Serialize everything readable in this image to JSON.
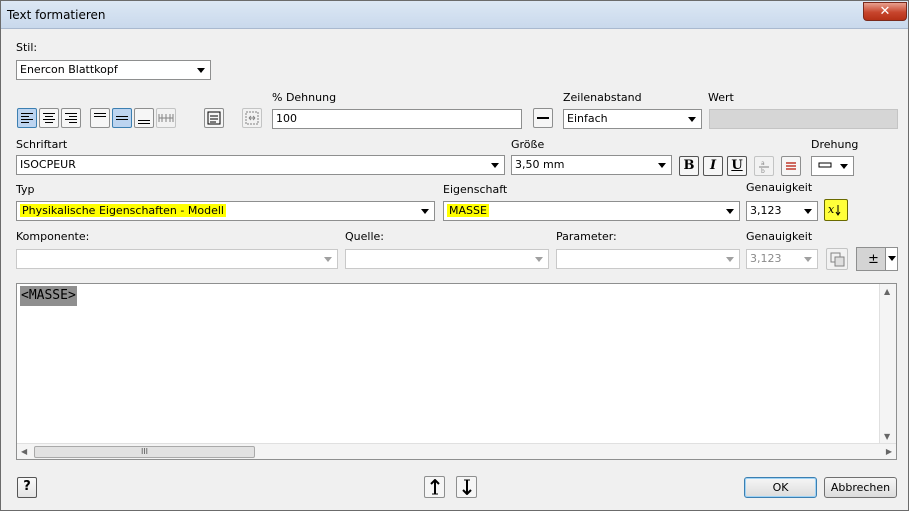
{
  "window": {
    "title": "Text formatieren",
    "close_glyph": "✕"
  },
  "style": {
    "label": "Stil:",
    "value": "Enercon Blattkopf"
  },
  "stretch": {
    "label": "% Dehnung",
    "value": "100"
  },
  "line_spacing": {
    "label": "Zeilenabstand",
    "value": "Einfach"
  },
  "value_field": {
    "label": "Wert",
    "value": ""
  },
  "font": {
    "label": "Schriftart",
    "value": "ISOCPEUR"
  },
  "size": {
    "label": "Größe",
    "value": "3,50 mm"
  },
  "format": {
    "bold": "B",
    "italic": "I",
    "underline": "U"
  },
  "rotation": {
    "label": "Drehung"
  },
  "type": {
    "label": "Typ",
    "value": "Physikalische Eigenschaften - Modell"
  },
  "property": {
    "label": "Eigenschaft",
    "value": "MASSE"
  },
  "precision": {
    "label": "Genauigkeit",
    "value": "3,123"
  },
  "component": {
    "label": "Komponente:",
    "value": ""
  },
  "source": {
    "label": "Quelle:",
    "value": ""
  },
  "parameter": {
    "label": "Parameter:",
    "value": ""
  },
  "precision2": {
    "label": "Genauigkeit",
    "value": "3,123"
  },
  "symbol": {
    "glyph": "±"
  },
  "editor": {
    "content": "<MASSE>"
  },
  "scroll": {
    "thumb_glyph": "III"
  },
  "footer": {
    "help": "?",
    "ok": "OK",
    "cancel": "Abbrechen"
  },
  "colors": {
    "highlight": "#ffff00",
    "active_tool": "#bcd4f0"
  }
}
